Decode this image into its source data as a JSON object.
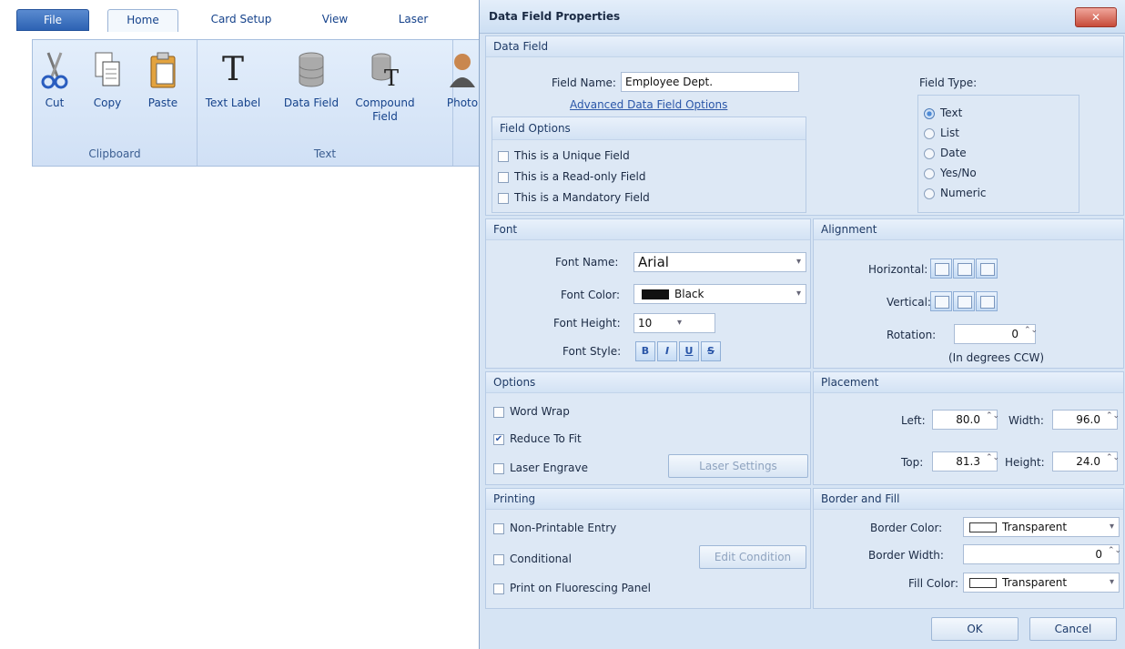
{
  "ribbon": {
    "tabs": [
      "File",
      "Home",
      "Card Setup",
      "View",
      "Laser"
    ],
    "buttons": {
      "cut": "Cut",
      "copy": "Copy",
      "paste": "Paste",
      "text_label": "Text Label",
      "data_field": "Data Field",
      "compound_field": "Compound Field",
      "photo": "Photo"
    },
    "groups": {
      "clipboard": "Clipboard",
      "text": "Text"
    }
  },
  "dialog": {
    "title": "Data Field Properties",
    "close_glyph": "✕",
    "data_field": {
      "header": "Data Field",
      "field_name_label": "Field Name:",
      "field_name_value": "Employee Dept.",
      "advanced_link": "Advanced Data Field Options",
      "field_options_header": "Field Options",
      "options": [
        {
          "label": "This is a Unique Field",
          "checked": false
        },
        {
          "label": "This is a Read-only Field",
          "checked": false
        },
        {
          "label": "This is a Mandatory Field",
          "checked": false
        }
      ],
      "field_type_label": "Field Type:",
      "field_types": [
        {
          "label": "Text",
          "selected": true
        },
        {
          "label": "List",
          "selected": false
        },
        {
          "label": "Date",
          "selected": false
        },
        {
          "label": "Yes/No",
          "selected": false
        },
        {
          "label": "Numeric",
          "selected": false
        }
      ]
    },
    "font": {
      "header": "Font",
      "name_label": "Font Name:",
      "name_value": "Arial",
      "color_label": "Font Color:",
      "color_value": "Black",
      "color_hex": "#000000",
      "height_label": "Font Height:",
      "height_value": "10",
      "style_label": "Font Style:",
      "style_buttons": [
        "B",
        "I",
        "U",
        "S"
      ]
    },
    "alignment": {
      "header": "Alignment",
      "horizontal_label": "Horizontal:",
      "vertical_label": "Vertical:",
      "rotation_label": "Rotation:",
      "rotation_value": "0",
      "rotation_note": "(In degrees CCW)"
    },
    "options": {
      "header": "Options",
      "word_wrap": {
        "label": "Word Wrap",
        "checked": false
      },
      "reduce_to_fit": {
        "label": "Reduce To Fit",
        "checked": true
      },
      "laser_engrave": {
        "label": "Laser Engrave",
        "checked": false
      },
      "laser_settings_button": "Laser Settings"
    },
    "placement": {
      "header": "Placement",
      "left_label": "Left:",
      "left_value": "80.0",
      "width_label": "Width:",
      "width_value": "96.0",
      "top_label": "Top:",
      "top_value": "81.3",
      "height_label": "Height:",
      "height_value": "24.0"
    },
    "printing": {
      "header": "Printing",
      "non_printable": {
        "label": "Non-Printable Entry",
        "checked": false
      },
      "conditional": {
        "label": "Conditional",
        "checked": false
      },
      "fluorescing": {
        "label": "Print on Fluorescing Panel",
        "checked": false
      },
      "edit_condition_button": "Edit Condition"
    },
    "border_fill": {
      "header": "Border and Fill",
      "border_color_label": "Border Color:",
      "border_color_value": "Transparent",
      "border_width_label": "Border Width:",
      "border_width_value": "0",
      "fill_color_label": "Fill Color:",
      "fill_color_value": "Transparent"
    },
    "ok_button": "OK",
    "cancel_button": "Cancel",
    "spin_glyph": "⌃⌄",
    "dropdown_glyph": "▾"
  }
}
